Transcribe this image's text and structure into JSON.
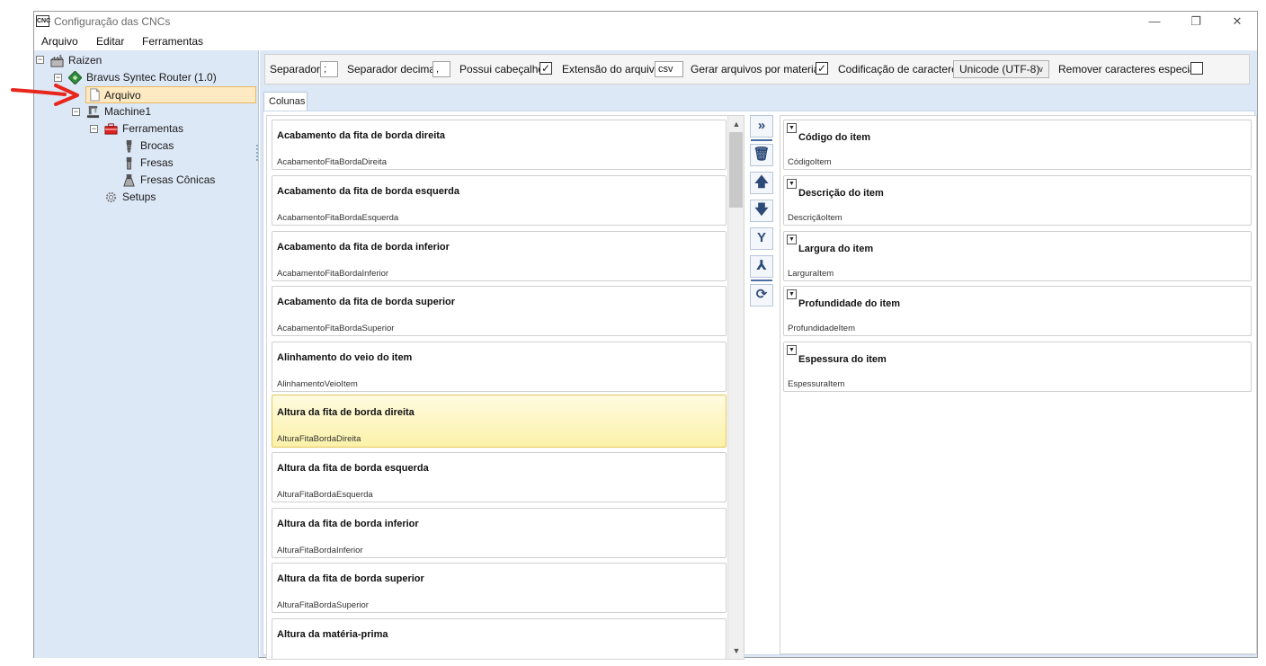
{
  "window": {
    "title": "Configuração das CNCs",
    "icon_text": "CNC",
    "controls": {
      "minimize": "—",
      "restore": "❐",
      "close": "✕"
    }
  },
  "menu": [
    "Arquivo",
    "Editar",
    "Ferramentas"
  ],
  "tree": {
    "root": "Raizen",
    "router": "Bravus Syntec Router (1.0)",
    "arquivo": "Arquivo",
    "machine": "Machine1",
    "ferramentas": "Ferramentas",
    "brocas": "Brocas",
    "fresas": "Fresas",
    "fresas_conicas": "Fresas Cônicas",
    "setups": "Setups",
    "expander_symbol": "−"
  },
  "options": {
    "separador_label": "Separador",
    "separador_value": ";",
    "separador_decimal_label": "Separador decimal",
    "separador_decimal_value": ",",
    "possui_cabecalho_label": "Possui cabeçalho",
    "possui_cabecalho_checked": "✓",
    "extensao_label": "Extensão do arquivo",
    "extensao_value": "csv",
    "gerar_por_material_label": "Gerar arquivos por material",
    "gerar_por_material_checked": "✓",
    "codificacao_label": "Codificação de caracteres",
    "codificacao_value": "Unicode (UTF-8)",
    "remover_especiais_label": "Remover caracteres especiais"
  },
  "tab_label": "Colunas",
  "available_columns": [
    {
      "title": "Acabamento da fita de borda direita",
      "field": "AcabamentoFitaBordaDireita"
    },
    {
      "title": "Acabamento da fita de borda esquerda",
      "field": "AcabamentoFitaBordaEsquerda"
    },
    {
      "title": "Acabamento da fita de borda inferior",
      "field": "AcabamentoFitaBordaInferior"
    },
    {
      "title": "Acabamento da fita de borda superior",
      "field": "AcabamentoFitaBordaSuperior"
    },
    {
      "title": "Alinhamento do veio do item",
      "field": "AlinhamentoVeioItem"
    },
    {
      "title": "Altura da fita de borda direita",
      "field": "AlturaFitaBordaDireita"
    },
    {
      "title": "Altura da fita de borda esquerda",
      "field": "AlturaFitaBordaEsquerda"
    },
    {
      "title": "Altura da fita de borda inferior",
      "field": "AlturaFitaBordaInferior"
    },
    {
      "title": "Altura da fita de borda superior",
      "field": "AlturaFitaBordaSuperior"
    },
    {
      "title": "Altura da matéria-prima",
      "field": ""
    }
  ],
  "selected_columns": [
    {
      "title": "Código do item",
      "field": "CódigoItem"
    },
    {
      "title": "Descrição do item",
      "field": "DescriçãoItem"
    },
    {
      "title": "Largura do item",
      "field": "LarguraItem"
    },
    {
      "title": "Profundidade do item",
      "field": "ProfundidadeItem"
    },
    {
      "title": "Espessura do item",
      "field": "EspessuraItem"
    }
  ],
  "toolbar": {
    "add_all": "»",
    "delete": "🗑",
    "move_up": "🡅",
    "move_down": "🡇",
    "merge": "Y",
    "split": "⅄",
    "refresh": "⟳"
  },
  "scroll": {
    "up": "▲",
    "down": "▼"
  },
  "collapse_symbol": "▼",
  "colors": {
    "sidebar_bg": "#dde8f6",
    "selection_bg": "#fde9c2",
    "highlight_card": "#fbf1a9",
    "arrow_red": "#e8261c"
  }
}
